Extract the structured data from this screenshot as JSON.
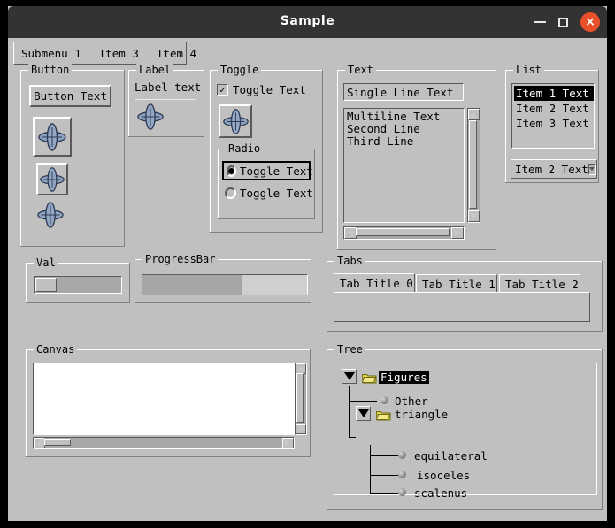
{
  "window": {
    "title": "Sample",
    "controls": {
      "minimize": "minimize-icon",
      "maximize": "maximize-icon",
      "close": "×"
    },
    "colors": {
      "titlebar_bg": "#333333",
      "close_button": "#e8502a",
      "client_bg": "#c0c0c0",
      "selection_bg": "#000000",
      "folder_icon": "#e8d44a",
      "widget_icon": "#8fa3c0"
    }
  },
  "menubar": {
    "items": [
      {
        "label": "Submenu 1"
      },
      {
        "label": "Item 3"
      },
      {
        "label": "Item 4"
      }
    ]
  },
  "groups": {
    "button": {
      "legend": "Button",
      "text_button": "Button Text",
      "icon_buttons": [
        {
          "name": "icon-button-large",
          "icon": "orbit-icon"
        },
        {
          "name": "icon-button-medium",
          "icon": "orbit-icon"
        },
        {
          "name": "icon-button-flat",
          "icon": "orbit-icon"
        }
      ]
    },
    "label": {
      "legend": "Label",
      "text": "Label text",
      "icon": "orbit-icon"
    },
    "toggle": {
      "legend": "Toggle",
      "checkbox": {
        "label": "Toggle Text",
        "checked": true,
        "check_glyph": "✓"
      },
      "icon_toggle": {
        "icon": "orbit-icon",
        "pressed": true
      },
      "radio": {
        "legend": "Radio",
        "items": [
          {
            "label": "Toggle Text",
            "selected": true,
            "focused": true
          },
          {
            "label": "Toggle Text",
            "selected": false,
            "focused": false
          }
        ]
      }
    },
    "text": {
      "legend": "Text",
      "single_line": {
        "value": "Single Line Text",
        "placeholder": "Single Line Text"
      },
      "multiline": {
        "lines": [
          "Multiline Text",
          "Second Line",
          "Third Line"
        ],
        "value": "Multiline Text\nSecond Line\nThird Line"
      }
    },
    "list": {
      "legend": "List",
      "items": [
        {
          "label": "Item 1 Text",
          "selected": true
        },
        {
          "label": "Item 2 Text",
          "selected": false
        },
        {
          "label": "Item 3 Text",
          "selected": false
        }
      ],
      "dropdown": {
        "value": "Item 2 Text",
        "options": [
          "Item 1 Text",
          "Item 2 Text",
          "Item 3 Text"
        ]
      }
    },
    "val": {
      "legend": "Val",
      "slider": {
        "value": 0,
        "min": 0,
        "max": 100
      }
    },
    "progress": {
      "legend": "ProgressBar",
      "percent": 60
    },
    "tabs": {
      "legend": "Tabs",
      "items": [
        {
          "label": "Tab Title 0",
          "active": true
        },
        {
          "label": "Tab Title 1",
          "active": false
        },
        {
          "label": "Tab Title 2",
          "active": false
        }
      ]
    },
    "canvas": {
      "legend": "Canvas"
    },
    "tree": {
      "legend": "Tree",
      "nodes": [
        {
          "label": "Figures",
          "icon": "folder-open-icon",
          "expanded": true,
          "selected": true,
          "depth": 0
        },
        {
          "label": "Other",
          "icon": "sphere-icon",
          "expanded": false,
          "selected": false,
          "depth": 1
        },
        {
          "label": "triangle",
          "icon": "folder-open-icon",
          "expanded": true,
          "selected": false,
          "depth": 1
        },
        {
          "label": "equilateral",
          "icon": "sphere-icon",
          "expanded": false,
          "selected": false,
          "depth": 2
        },
        {
          "label": "isoceles",
          "icon": "sphere-icon",
          "expanded": false,
          "selected": false,
          "depth": 2
        },
        {
          "label": "scalenus",
          "icon": "sphere-icon",
          "expanded": false,
          "selected": false,
          "depth": 2
        }
      ]
    }
  }
}
